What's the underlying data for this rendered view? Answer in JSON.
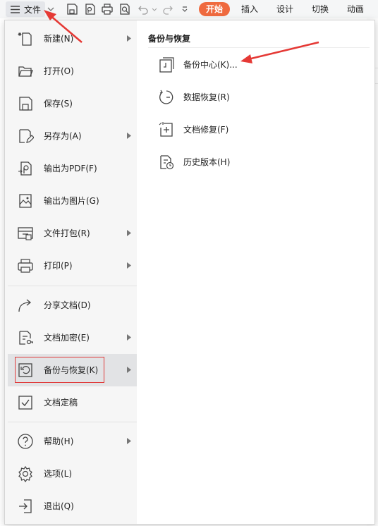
{
  "toolbar": {
    "file_label": "文件",
    "tabs": {
      "start": "开始",
      "insert": "插入",
      "design": "设计",
      "switch": "切换",
      "animation": "动画"
    }
  },
  "menu": {
    "items": [
      {
        "label": "新建(N)",
        "icon": "new-file-icon",
        "has_submenu": true
      },
      {
        "label": "打开(O)",
        "icon": "folder-open-icon",
        "has_submenu": false
      },
      {
        "label": "保存(S)",
        "icon": "save-icon",
        "has_submenu": false
      },
      {
        "label": "另存为(A)",
        "icon": "save-as-icon",
        "has_submenu": true
      },
      {
        "label": "输出为PDF(F)",
        "icon": "pdf-icon",
        "has_submenu": false
      },
      {
        "label": "输出为图片(G)",
        "icon": "image-icon",
        "has_submenu": false
      },
      {
        "label": "文件打包(R)",
        "icon": "package-icon",
        "has_submenu": true
      },
      {
        "label": "打印(P)",
        "icon": "printer-icon",
        "has_submenu": true
      },
      {
        "label": "分享文档(D)",
        "icon": "share-icon",
        "has_submenu": false
      },
      {
        "label": "文档加密(E)",
        "icon": "lock-document-icon",
        "has_submenu": true
      },
      {
        "label": "备份与恢复(K)",
        "icon": "backup-icon",
        "has_submenu": true,
        "selected": true
      },
      {
        "label": "文档定稿",
        "icon": "finalize-icon",
        "has_submenu": false
      },
      {
        "label": "帮助(H)",
        "icon": "help-icon",
        "has_submenu": true
      },
      {
        "label": "选项(L)",
        "icon": "gear-icon",
        "has_submenu": false
      },
      {
        "label": "退出(Q)",
        "icon": "exit-icon",
        "has_submenu": false
      }
    ]
  },
  "submenu": {
    "title": "备份与恢复",
    "items": [
      {
        "label": "备份中心(K)...",
        "icon": "backup-center-icon"
      },
      {
        "label": "数据恢复(R)",
        "icon": "data-recovery-icon"
      },
      {
        "label": "文档修复(F)",
        "icon": "document-repair-icon"
      },
      {
        "label": "历史版本(H)",
        "icon": "history-version-icon"
      }
    ]
  },
  "colors": {
    "accent": "#ef6a3f",
    "highlight_border": "#e03a3a",
    "annotation_arrow": "#e53935"
  }
}
